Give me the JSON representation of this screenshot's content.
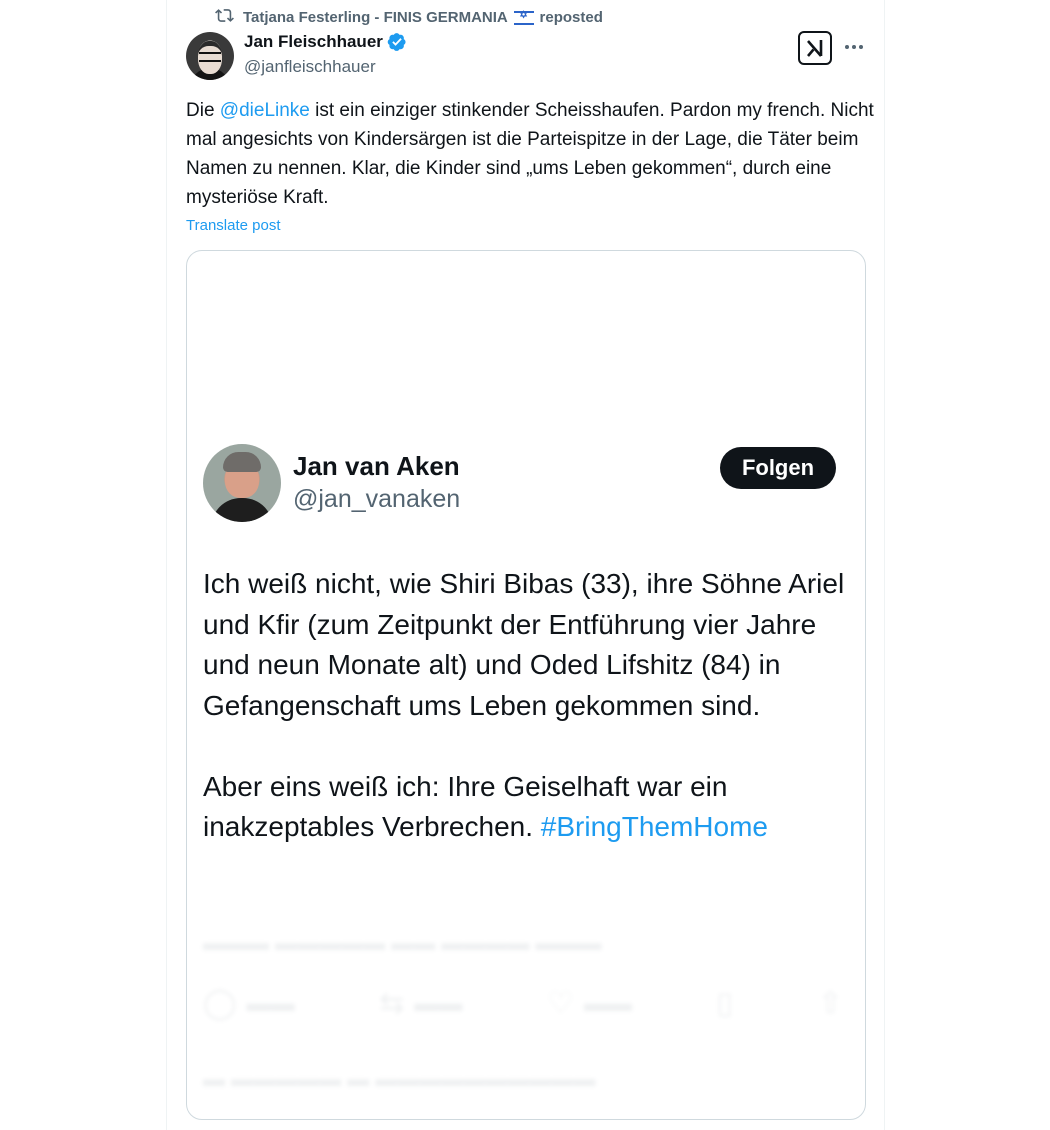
{
  "repost": {
    "icon": "repost-icon",
    "user": "Tatjana Festerling - FINIS GERMANIA",
    "flag": "israel-flag",
    "suffix": "reposted"
  },
  "post": {
    "author_name": "Jan Fleischhauer",
    "author_handle": "@janfleischhauer",
    "text_before": "Die ",
    "mention": "@dieLinke",
    "text_after": " ist ein einziger stinkender Scheisshaufen. Pardon my french. Nicht mal angesichts von Kindersärgen ist die Parteispitze in der Lage, die Täter beim Namen zu nennen. Klar, die Kinder sind „ums Leben gekommen“, durch eine mysteriöse Kraft.",
    "translate_label": "Translate post"
  },
  "embedded": {
    "name": "Jan van Aken",
    "handle": "@jan_vanaken",
    "follow_label": "Folgen",
    "paragraph1": "Ich weiß nicht, wie Shiri Bibas (33), ihre Söhne Ariel und Kfir (zum Zeitpunkt der Entführung vier Jahre und neun Monate alt) und Oded Lifshitz (84) in Gefangenschaft ums Leben gekommen sind.",
    "paragraph2_text": "Aber eins weiß ich: Ihre Geiselhaft war ein inakzeptables Verbrechen. ",
    "hashtag": "#BringThemHome"
  },
  "colors": {
    "accent": "#1d9bf0",
    "text": "#0f1419",
    "secondary": "#536471",
    "border": "#cfd9de"
  }
}
